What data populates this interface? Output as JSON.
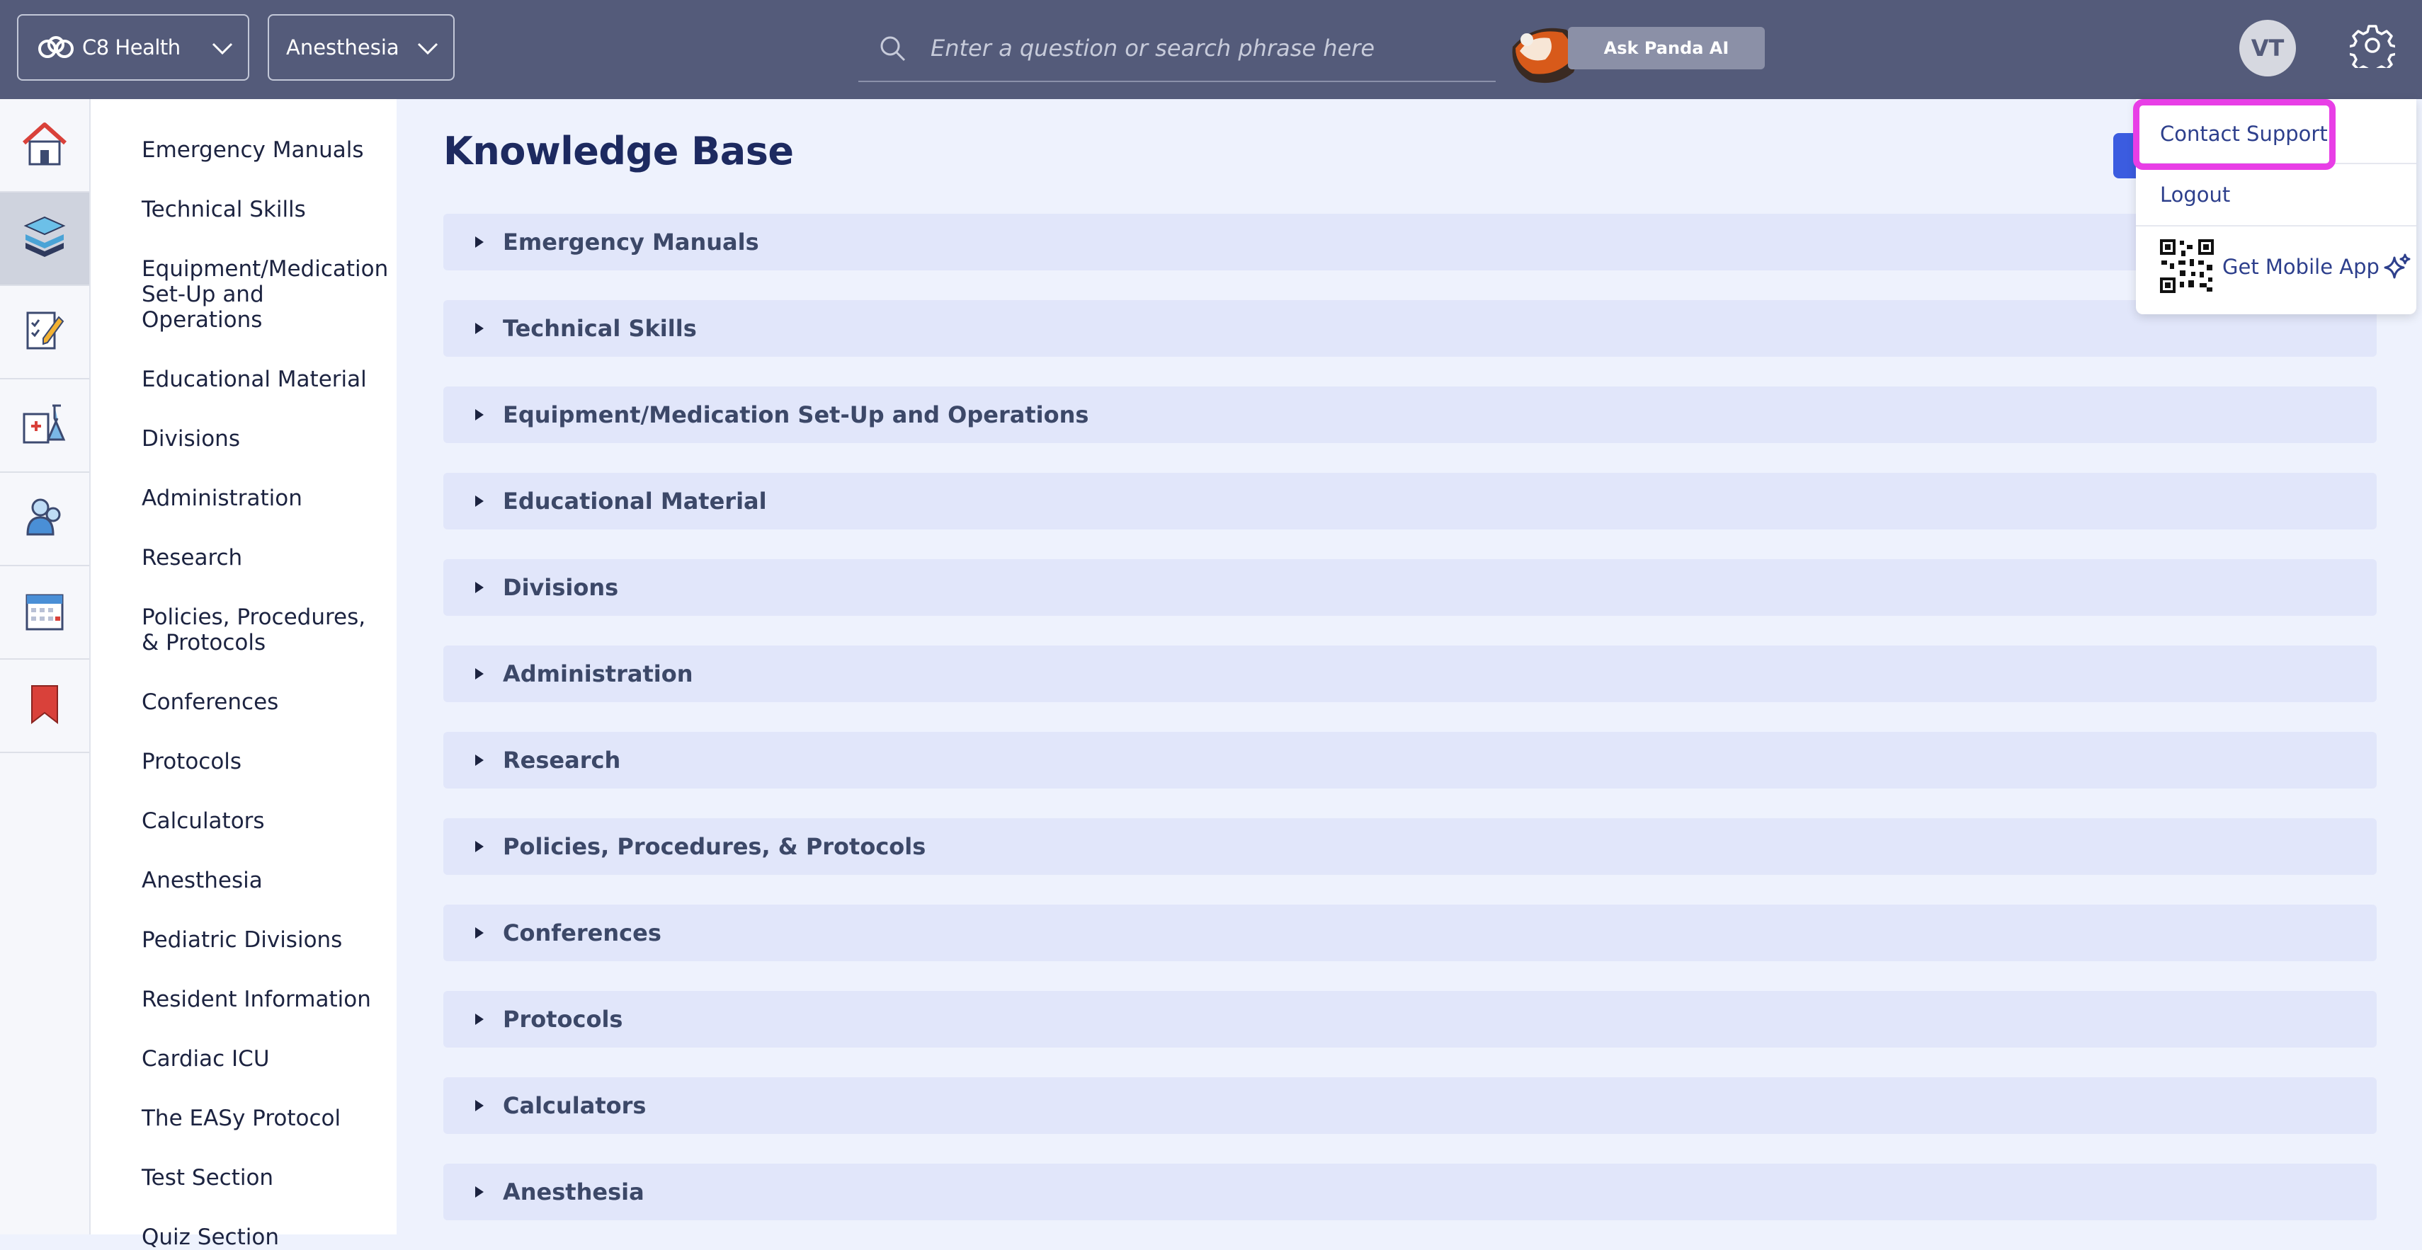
{
  "header": {
    "org_name": "C8 Health",
    "specialty": "Anesthesia",
    "search_placeholder": "Enter a question or search phrase here",
    "ask_ai_label": "Ask Panda AI",
    "avatar_initials": "VT"
  },
  "rail": {
    "icons": [
      "home-icon",
      "books-icon",
      "checklist-icon",
      "lab-icon",
      "people-icon",
      "calendar-icon",
      "bookmark-icon"
    ],
    "active_icon": "books-icon"
  },
  "nav": {
    "items": [
      "Emergency Manuals",
      "Technical Skills",
      "Equipment/Medication Set-Up and Operations",
      "Educational Material",
      "Divisions",
      "Administration",
      "Research",
      "Policies, Procedures, & Protocols",
      "Conferences",
      "Protocols",
      "Calculators",
      "Anesthesia",
      "Pediatric Divisions",
      "Resident Information",
      "Cardiac ICU",
      "The EASy Protocol",
      "Test Section",
      "Quiz Section"
    ]
  },
  "main": {
    "title": "Knowledge Base",
    "sections": [
      "Emergency Manuals",
      "Technical Skills",
      "Equipment/Medication Set-Up and Operations",
      "Educational Material",
      "Divisions",
      "Administration",
      "Research",
      "Policies, Procedures, & Protocols",
      "Conferences",
      "Protocols",
      "Calculators",
      "Anesthesia"
    ]
  },
  "user_menu": {
    "contact_support": "Contact Support",
    "logout": "Logout",
    "get_mobile_app": "Get Mobile App"
  },
  "colors": {
    "topbar": "#545b7a",
    "accent": "#2d3f8c",
    "highlight": "#e83ee6",
    "section_bg": "#e1e6fa"
  }
}
